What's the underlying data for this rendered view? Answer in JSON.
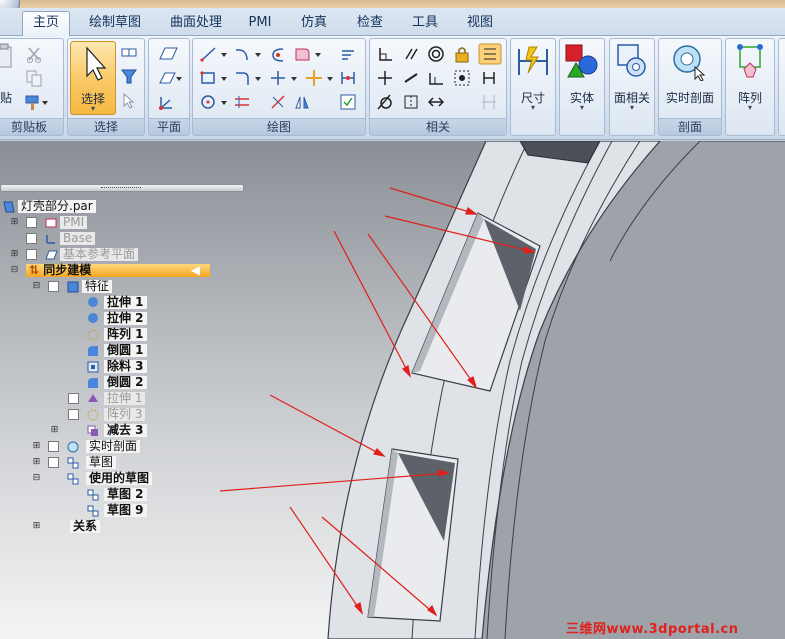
{
  "tabs": [
    {
      "label": "主页",
      "active": true
    },
    {
      "label": "绘制草图",
      "active": false
    },
    {
      "label": "曲面处理",
      "active": false
    },
    {
      "label": "PMI",
      "active": false
    },
    {
      "label": "仿真",
      "active": false
    },
    {
      "label": "检查",
      "active": false
    },
    {
      "label": "工具",
      "active": false
    },
    {
      "label": "视图",
      "active": false
    }
  ],
  "ribbon": {
    "clipboard": {
      "group_label": "剪贴板",
      "paste_label": "贴"
    },
    "select": {
      "group_label": "选择",
      "select_label": "选择"
    },
    "plane": {
      "group_label": "平面"
    },
    "draw": {
      "group_label": "绘图"
    },
    "relate": {
      "group_label": "相关"
    },
    "dimension": {
      "label": "尺寸"
    },
    "solid": {
      "label": "实体"
    },
    "face_relate": {
      "label": "面相关"
    },
    "live_section": {
      "label": "实时剖面",
      "group_label": "剖面"
    },
    "pattern": {
      "label": "阵列"
    }
  },
  "tree": {
    "root": "灯壳部分.par",
    "pmi": "PMI",
    "base": "Base",
    "ref_planes": "基本参考平面",
    "sync": "同步建模",
    "features": "特征",
    "feature_items": [
      {
        "label": "拉伸 1"
      },
      {
        "label": "拉伸 2"
      },
      {
        "label": "阵列 1"
      },
      {
        "label": "倒圆 1"
      },
      {
        "label": "除料 3"
      },
      {
        "label": "倒圆 2"
      }
    ],
    "dim_items": [
      {
        "label": "拉伸 1"
      },
      {
        "label": "阵列 3"
      }
    ],
    "subtract": "减去 3",
    "live_section": "实时剖面",
    "sketch": "草图",
    "used_sketch": "使用的草图",
    "sketch_items": [
      {
        "label": "草图 2"
      },
      {
        "label": "草图 9"
      }
    ],
    "relations": "关系"
  },
  "watermark": "三维网www.3dportal.cn",
  "colors": {
    "accent": "#f5a623",
    "ribbon": "#dce6f2",
    "annotation_arrow": "#e0201a"
  }
}
